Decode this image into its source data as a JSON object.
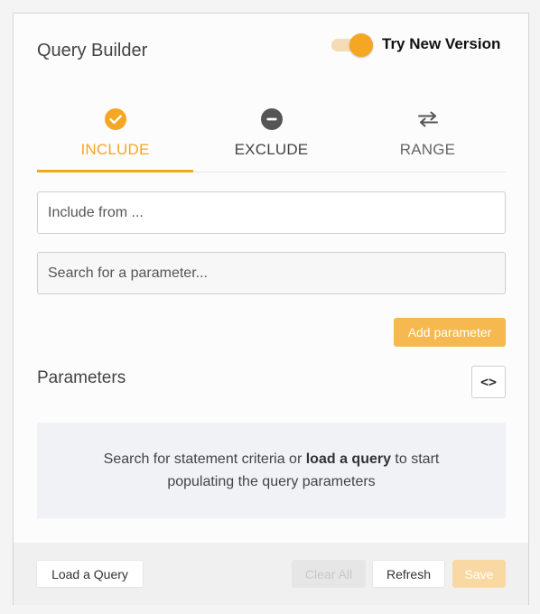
{
  "header": {
    "title": "Query Builder",
    "toggle_label": "Try New Version",
    "toggle_on": true
  },
  "tabs": [
    {
      "label": "INCLUDE",
      "icon": "check-circle-icon",
      "active": true
    },
    {
      "label": "EXCLUDE",
      "icon": "minus-circle-icon",
      "active": false
    },
    {
      "label": "RANGE",
      "icon": "swap-arrows-icon",
      "active": false
    }
  ],
  "include_field": {
    "placeholder": "Include from ...",
    "value": ""
  },
  "search_field": {
    "placeholder": "Search for a parameter...",
    "value": ""
  },
  "add_parameter_label": "Add parameter",
  "parameters": {
    "title": "Parameters",
    "code_toggle_glyph": "<>",
    "empty_before": "Search for statement criteria or ",
    "empty_link": "load a query",
    "empty_after": " to start populating the query parameters"
  },
  "footer": {
    "load_label": "Load a Query",
    "clear_label": "Clear All",
    "refresh_label": "Refresh",
    "save_label": "Save"
  },
  "colors": {
    "accent": "#f5a623",
    "accent_light": "#f5b94f",
    "dark_icon": "#555555"
  }
}
